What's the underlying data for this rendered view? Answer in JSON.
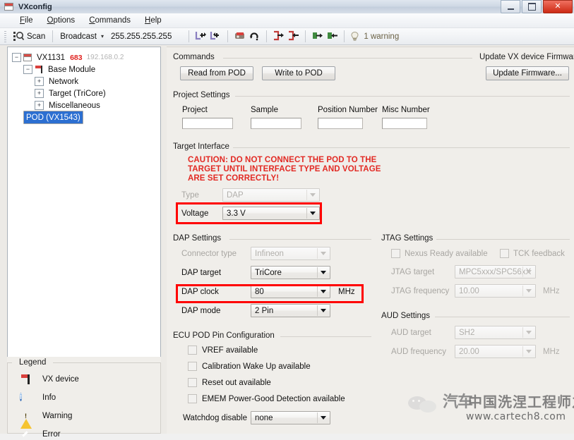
{
  "window": {
    "title": "VXconfig",
    "icon": "app-icon",
    "controls": {
      "minimize": "minimize",
      "maximize": "maximize",
      "close": "close"
    }
  },
  "menu": {
    "items": [
      {
        "label": "File",
        "mnemonic": "F"
      },
      {
        "label": "Options",
        "mnemonic": "O"
      },
      {
        "label": "Commands",
        "mnemonic": "C"
      },
      {
        "label": "Help",
        "mnemonic": "H"
      }
    ]
  },
  "toolbar": {
    "scan_label": "Scan",
    "broadcast_label": "Broadcast",
    "broadcast_arrow": "▾",
    "ip_address": "255.255.255.255",
    "icons": [
      "read-config-icon",
      "write-config-icon",
      "erase-icon",
      "reset-icon",
      "export-out-icon",
      "import-in-icon",
      "upload-green-icon",
      "download-green-icon"
    ],
    "warning_count_label": "1 warning",
    "warning_icon": "lightbulb-icon"
  },
  "tree": {
    "root": {
      "label": "VX1131",
      "badge": "683",
      "ip": "192.168.0.2",
      "icon": "vx-device-icon",
      "expander": "−"
    },
    "base_module": {
      "label": "Base Module",
      "icon": "flag-icon",
      "expander": "−"
    },
    "children": [
      {
        "label": "Network",
        "expander": "+"
      },
      {
        "label": "Target (TriCore)",
        "expander": "+"
      },
      {
        "label": "Miscellaneous",
        "expander": "+"
      }
    ],
    "selected": {
      "label": "POD (VX1543)",
      "icon": "pod-icon"
    }
  },
  "legend": {
    "title": "Legend",
    "items": [
      {
        "label": "VX device",
        "icon": "vx-device-flag-icon"
      },
      {
        "label": "Info",
        "icon": "info-icon",
        "glyph": "i"
      },
      {
        "label": "Warning",
        "icon": "warning-triangle-icon"
      },
      {
        "label": "Error",
        "icon": "error-icon"
      }
    ]
  },
  "commands": {
    "title": "Commands",
    "read_from_pod": "Read from POD",
    "write_to_pod": "Write to POD"
  },
  "firmware": {
    "title": "Update VX device Firmware",
    "update_button": "Update Firmware..."
  },
  "project_settings": {
    "title": "Project Settings",
    "fields": [
      {
        "label": "Project",
        "value": ""
      },
      {
        "label": "Sample",
        "value": ""
      },
      {
        "label": "Position Number",
        "value": ""
      },
      {
        "label": "Misc Number",
        "value": ""
      }
    ]
  },
  "target_interface": {
    "title": "Target Interface",
    "caution_line1": "CAUTION: DO NOT CONNECT THE POD TO THE",
    "caution_line2": "TARGET UNTIL INTERFACE TYPE AND VOLTAGE",
    "caution_line3": "ARE SET CORRECTLY!",
    "caution_color": "#e22a24",
    "type_label": "Type",
    "type_value": "DAP",
    "type_disabled": true,
    "voltage_label": "Voltage",
    "voltage_value": "3.3 V",
    "highlight_color": "#ff0000"
  },
  "dap_settings": {
    "title": "DAP Settings",
    "connector_type_label": "Connector type",
    "connector_type_value": "Infineon",
    "dap_target_label": "DAP target",
    "dap_target_value": "TriCore",
    "dap_clock_label": "DAP clock",
    "dap_clock_value": "80",
    "dap_clock_unit": "MHz",
    "dap_mode_label": "DAP mode",
    "dap_mode_value": "2 Pin"
  },
  "jtag_settings": {
    "title": "JTAG Settings",
    "nexus_ready_label": "Nexus Ready available",
    "tck_feedback_label": "TCK feedback",
    "jtag_target_label": "JTAG target",
    "jtag_target_value": "MPC5xxx/SPC56xX",
    "jtag_frequency_label": "JTAG frequency",
    "jtag_frequency_value": "10.00",
    "jtag_frequency_unit": "MHz"
  },
  "aud_settings": {
    "title": "AUD Settings",
    "aud_target_label": "AUD target",
    "aud_target_value": "SH2",
    "aud_frequency_label": "AUD frequency",
    "aud_frequency_value": "20.00",
    "aud_frequency_unit": "MHz"
  },
  "ecu_pod": {
    "title": "ECU POD Pin Configuration",
    "checkboxes": [
      {
        "label": "VREF available",
        "checked": false
      },
      {
        "label": "Calibration Wake Up available",
        "checked": false
      },
      {
        "label": "Reset out available",
        "checked": false
      },
      {
        "label": "EMEM Power-Good Detection available",
        "checked": false
      }
    ],
    "watchdog_label": "Watchdog disable",
    "watchdog_value": "none"
  },
  "watermark": {
    "cn_text_1": "汽车",
    "cn_text_2": "中国洗涅工程师之家",
    "url": "www.cartech8.com"
  }
}
